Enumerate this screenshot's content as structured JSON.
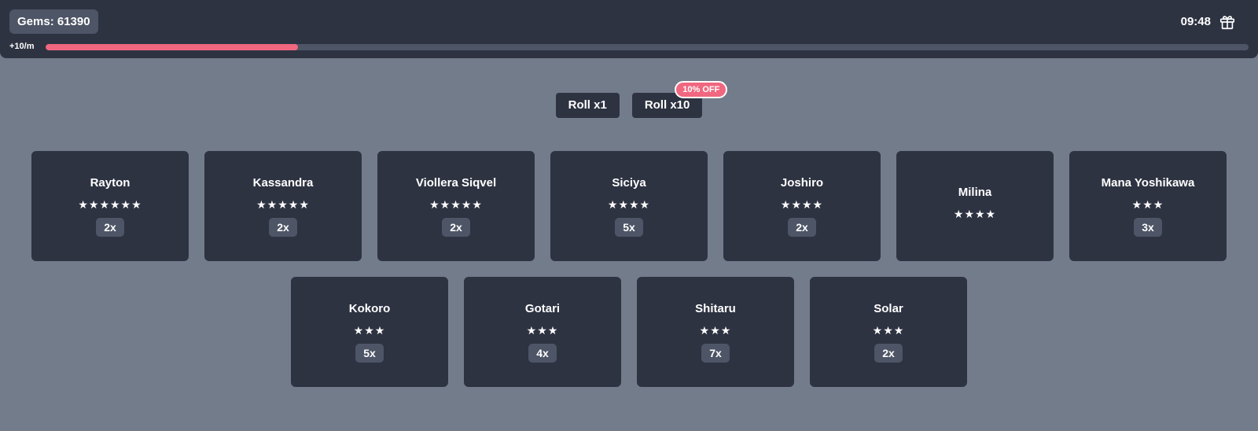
{
  "header": {
    "gems_label": "Gems: 61390",
    "rate_label": "+10/m",
    "time": "09:48",
    "progress_fraction": 0.21,
    "gift_icon": "gift-icon"
  },
  "roll": {
    "single_label": "Roll x1",
    "multi_label": "Roll x10",
    "discount_badge": "10% OFF"
  },
  "cards": [
    {
      "name": "Rayton",
      "stars": "★★★★★★",
      "count": "2x"
    },
    {
      "name": "Kassandra",
      "stars": "★★★★★",
      "count": "2x"
    },
    {
      "name": "Viollera Siqvel",
      "stars": "★★★★★",
      "count": "2x"
    },
    {
      "name": "Siciya",
      "stars": "★★★★",
      "count": "5x"
    },
    {
      "name": "Joshiro",
      "stars": "★★★★",
      "count": "2x"
    },
    {
      "name": "Milina",
      "stars": "★★★★",
      "count": ""
    },
    {
      "name": "Mana Yoshikawa",
      "stars": "★★★",
      "count": "3x"
    },
    {
      "name": "Kokoro",
      "stars": "★★★",
      "count": "5x"
    },
    {
      "name": "Gotari",
      "stars": "★★★",
      "count": "4x"
    },
    {
      "name": "Shitaru",
      "stars": "★★★",
      "count": "7x"
    },
    {
      "name": "Solar",
      "stars": "★★★",
      "count": "2x"
    }
  ],
  "colors": {
    "background": "#737c8b",
    "panel": "#2e3342",
    "chip": "#4d5566",
    "accent": "#f0677f"
  }
}
